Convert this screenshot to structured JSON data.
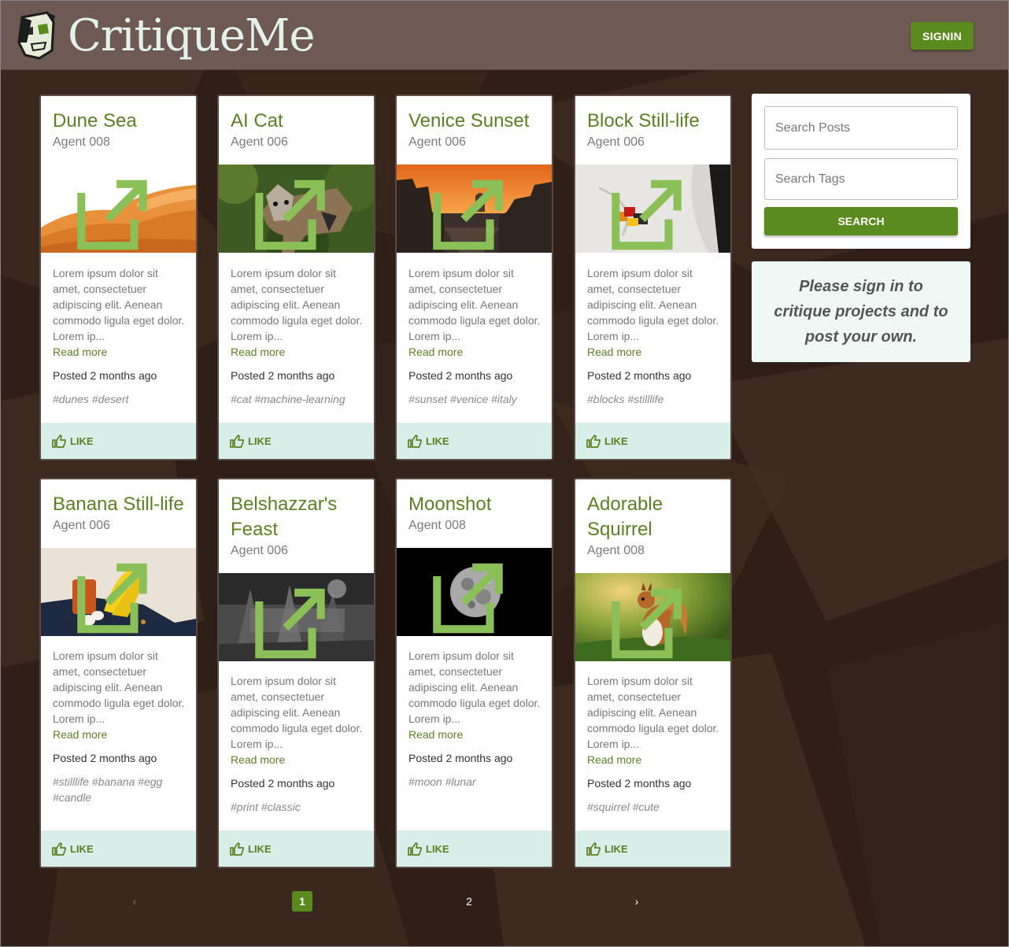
{
  "header": {
    "brand": "CritiqueMe",
    "signin_label": "SIGNIN"
  },
  "posts": [
    {
      "title": "Dune Sea",
      "author": "Agent 008",
      "image": "desert-dunes-photo",
      "excerpt": "Lorem ipsum dolor sit amet, consectetuer adipiscing elit. Aenean commodo ligula eget dolor. Lorem ip...",
      "read_more": "Read more",
      "posted": "Posted 2 months ago",
      "tags": "#dunes #desert",
      "like_label": "LIKE"
    },
    {
      "title": "AI Cat",
      "author": "Agent 006",
      "image": "ai-cat-artwork",
      "excerpt": "Lorem ipsum dolor sit amet, consectetuer adipiscing elit. Aenean commodo ligula eget dolor. Lorem ip...",
      "read_more": "Read more",
      "posted": "Posted 2 months ago",
      "tags": "#cat #machine-learning",
      "like_label": "LIKE"
    },
    {
      "title": "Venice Sunset",
      "author": "Agent 006",
      "image": "venice-canal-sunset-photo",
      "excerpt": "Lorem ipsum dolor sit amet, consectetuer adipiscing elit. Aenean commodo ligula eget dolor. Lorem ip...",
      "read_more": "Read more",
      "posted": "Posted 2 months ago",
      "tags": "#sunset #venice #italy",
      "like_label": "LIKE"
    },
    {
      "title": "Block Still-life",
      "author": "Agent 006",
      "image": "block-still-life-photo",
      "excerpt": "Lorem ipsum dolor sit amet, consectetuer adipiscing elit. Aenean commodo ligula eget dolor. Lorem ip...",
      "read_more": "Read more",
      "posted": "Posted 2 months ago",
      "tags": "#blocks #stilllife",
      "like_label": "LIKE"
    },
    {
      "title": "Banana Still-life",
      "author": "Agent 006",
      "image": "banana-still-life-photo",
      "excerpt": "Lorem ipsum dolor sit amet, consectetuer adipiscing elit. Aenean commodo ligula eget dolor. Lorem ip...",
      "read_more": "Read more",
      "posted": "Posted 2 months ago",
      "tags": "#stilllife #banana #egg #candle",
      "like_label": "LIKE"
    },
    {
      "title": "Belshazzar's Feast",
      "author": "Agent 006",
      "image": "belshazzars-feast-print",
      "excerpt": "Lorem ipsum dolor sit amet, consectetuer adipiscing elit. Aenean commodo ligula eget dolor. Lorem ip...",
      "read_more": "Read more",
      "posted": "Posted 2 months ago",
      "tags": "#print #classic",
      "like_label": "LIKE"
    },
    {
      "title": "Moonshot",
      "author": "Agent 008",
      "image": "moon-photo",
      "excerpt": "Lorem ipsum dolor sit amet, consectetuer adipiscing elit. Aenean commodo ligula eget dolor. Lorem ip...",
      "read_more": "Read more",
      "posted": "Posted 2 months ago",
      "tags": "#moon #lunar",
      "like_label": "LIKE"
    },
    {
      "title": "Adorable Squirrel",
      "author": "Agent 008",
      "image": "squirrel-photo",
      "excerpt": "Lorem ipsum dolor sit amet, consectetuer adipiscing elit. Aenean commodo ligula eget dolor. Lorem ip...",
      "read_more": "Read more",
      "posted": "Posted 2 months ago",
      "tags": "#squirrel #cute",
      "like_label": "LIKE"
    }
  ],
  "sidebar": {
    "search_posts_placeholder": "Search Posts",
    "search_tags_placeholder": "Search Tags",
    "search_label": "SEARCH",
    "signin_notice": "Please sign in to critique projects and to post your own."
  },
  "pagination": {
    "prev": "‹",
    "pages": [
      "1",
      "2"
    ],
    "current": "1",
    "next": "›"
  },
  "colors": {
    "header_bg": "#6e5a52",
    "accent_green": "#5b8a1f",
    "title_green": "#5d7f23",
    "like_bar": "#d7efe8",
    "page_bg": "#2f1f17"
  }
}
